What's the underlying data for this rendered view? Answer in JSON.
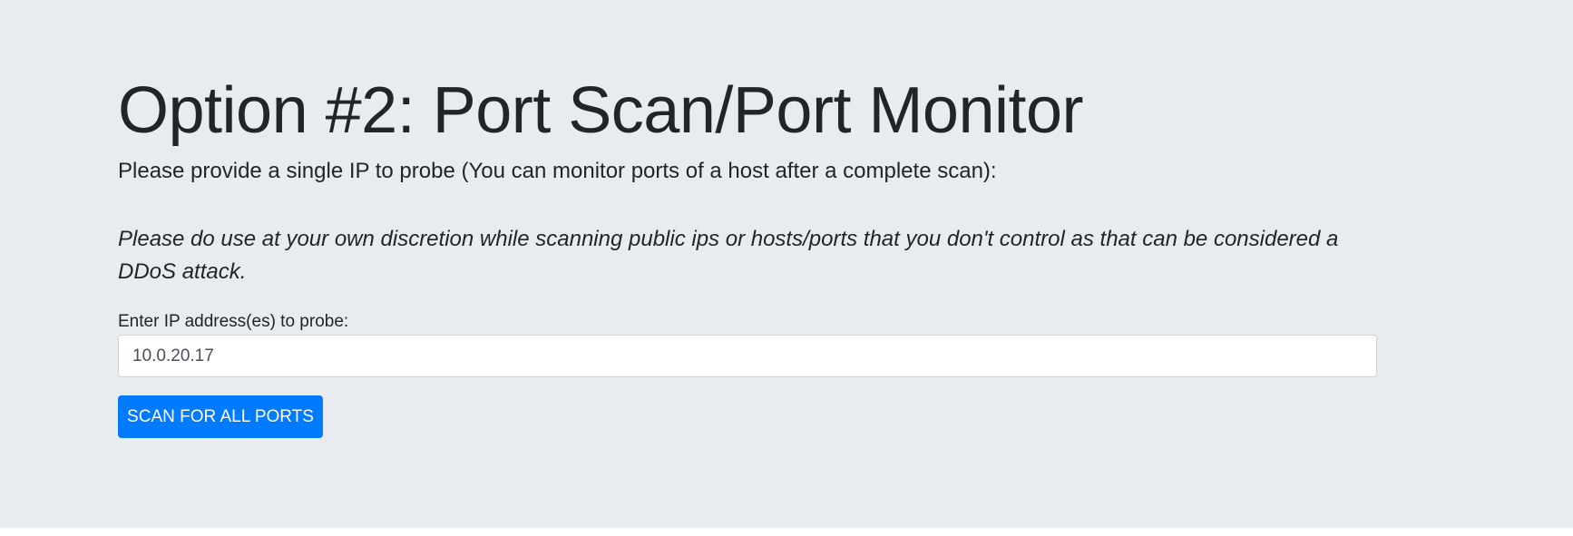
{
  "page": {
    "title": "Option #2: Port Scan/Port Monitor",
    "lead_before": "Please provide a ",
    "lead_emphasis": "single",
    "lead_after": " IP to probe (You can monitor ports of a host after a complete scan):",
    "warning": "Please do use at your own discretion while scanning public ips or hosts/ports that you don't control as that can be considered a DDoS attack."
  },
  "form": {
    "ip_label": "Enter IP address(es) to probe:",
    "ip_value": "10.0.20.17",
    "scan_button_label": "SCAN FOR ALL PORTS"
  },
  "colors": {
    "background": "#e9ecef",
    "accent": "#007bff"
  }
}
